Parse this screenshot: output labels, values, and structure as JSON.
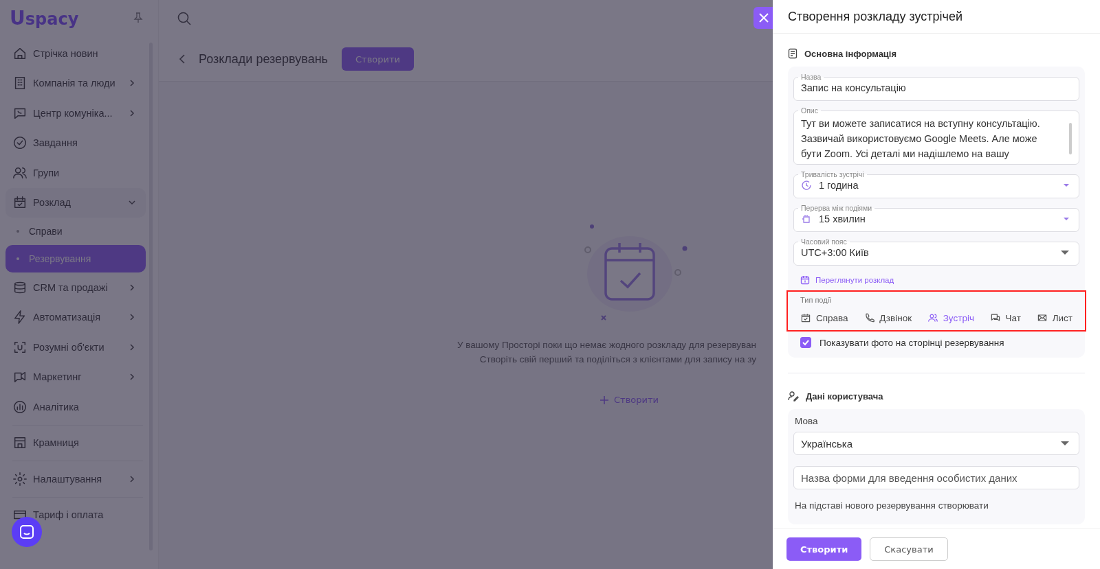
{
  "logo": {
    "mark": "U",
    "text": "spacy"
  },
  "sidebar": {
    "items": [
      {
        "label": "Стрічка новин",
        "expandable": false
      },
      {
        "label": "Компанія та люди",
        "expandable": true,
        "expanded": false
      },
      {
        "label": "Центр комуніка...",
        "expandable": true,
        "expanded": false
      },
      {
        "label": "Завдання",
        "expandable": false
      },
      {
        "label": "Групи",
        "expandable": false
      },
      {
        "label": "Розклад",
        "expandable": true,
        "expanded": true,
        "children": [
          {
            "label": "Справи",
            "selected": false
          },
          {
            "label": "Резервування",
            "selected": true
          }
        ]
      },
      {
        "label": "CRM та продажі",
        "expandable": true,
        "expanded": false
      },
      {
        "label": "Автоматизація",
        "expandable": true,
        "expanded": false
      },
      {
        "label": "Розумні об'єкти",
        "expandable": true,
        "expanded": false
      },
      {
        "label": "Маркетинг",
        "expandable": true,
        "expanded": false
      },
      {
        "label": "Аналітика",
        "expandable": false
      },
      {
        "label": "Крамниця",
        "expandable": false,
        "divider_before": true
      },
      {
        "label": "Налаштування",
        "expandable": true,
        "expanded": false,
        "divider_before": true
      },
      {
        "label": "Тариф і оплата",
        "expandable": false,
        "divider_before": true
      }
    ]
  },
  "page": {
    "title": "Розклади резервувань",
    "create_button": "Створити",
    "empty_state": {
      "lines": [
        "У вашому Просторі поки що немає жодного розкладу для резервуван",
        "Створіть свій перший та поділіться з клієнтами для запису на зу"
      ],
      "link": "Створити"
    }
  },
  "panel": {
    "title": "Створення розкладу зустрічей",
    "basic": {
      "title": "Основна інформація",
      "name": {
        "label": "Назва",
        "value": "Запис на консультацію"
      },
      "description": {
        "label": "Опис",
        "value": "Тут ви можете записатися на вступну консультацію. Зазвичай використовуємо Google Meets. Але може бути Zoom. Усі деталі ми надішлемо на вашу"
      },
      "duration": {
        "label": "Тривалість зустрічі",
        "value": "1 година"
      },
      "break": {
        "label": "Перерва між подіями",
        "value": "15 хвилин"
      },
      "timezone": {
        "label": "Часовий пояс",
        "value": "UTC+3:00 Київ"
      },
      "view_link": "Переглянути розклад",
      "event_type": {
        "label": "Тип події",
        "highlighted": true,
        "options": [
          {
            "label": "Справа",
            "selected": false
          },
          {
            "label": "Дзвінок",
            "selected": false
          },
          {
            "label": "Зустріч",
            "selected": true
          },
          {
            "label": "Чат",
            "selected": false
          },
          {
            "label": "Лист",
            "selected": false
          }
        ]
      },
      "show_photo": {
        "label": "Показувати фото на сторінці резервування",
        "checked": true
      }
    },
    "user_data": {
      "title": "Дані користувача",
      "language": {
        "label": "Мова",
        "value": "Українська"
      },
      "form_name": {
        "placeholder": "Назва форми для введення особистих даних"
      },
      "create_on_booking": "На підставі нового резервування створювати"
    },
    "buttons": {
      "primary": "Створити",
      "secondary": "Скасувати"
    }
  }
}
